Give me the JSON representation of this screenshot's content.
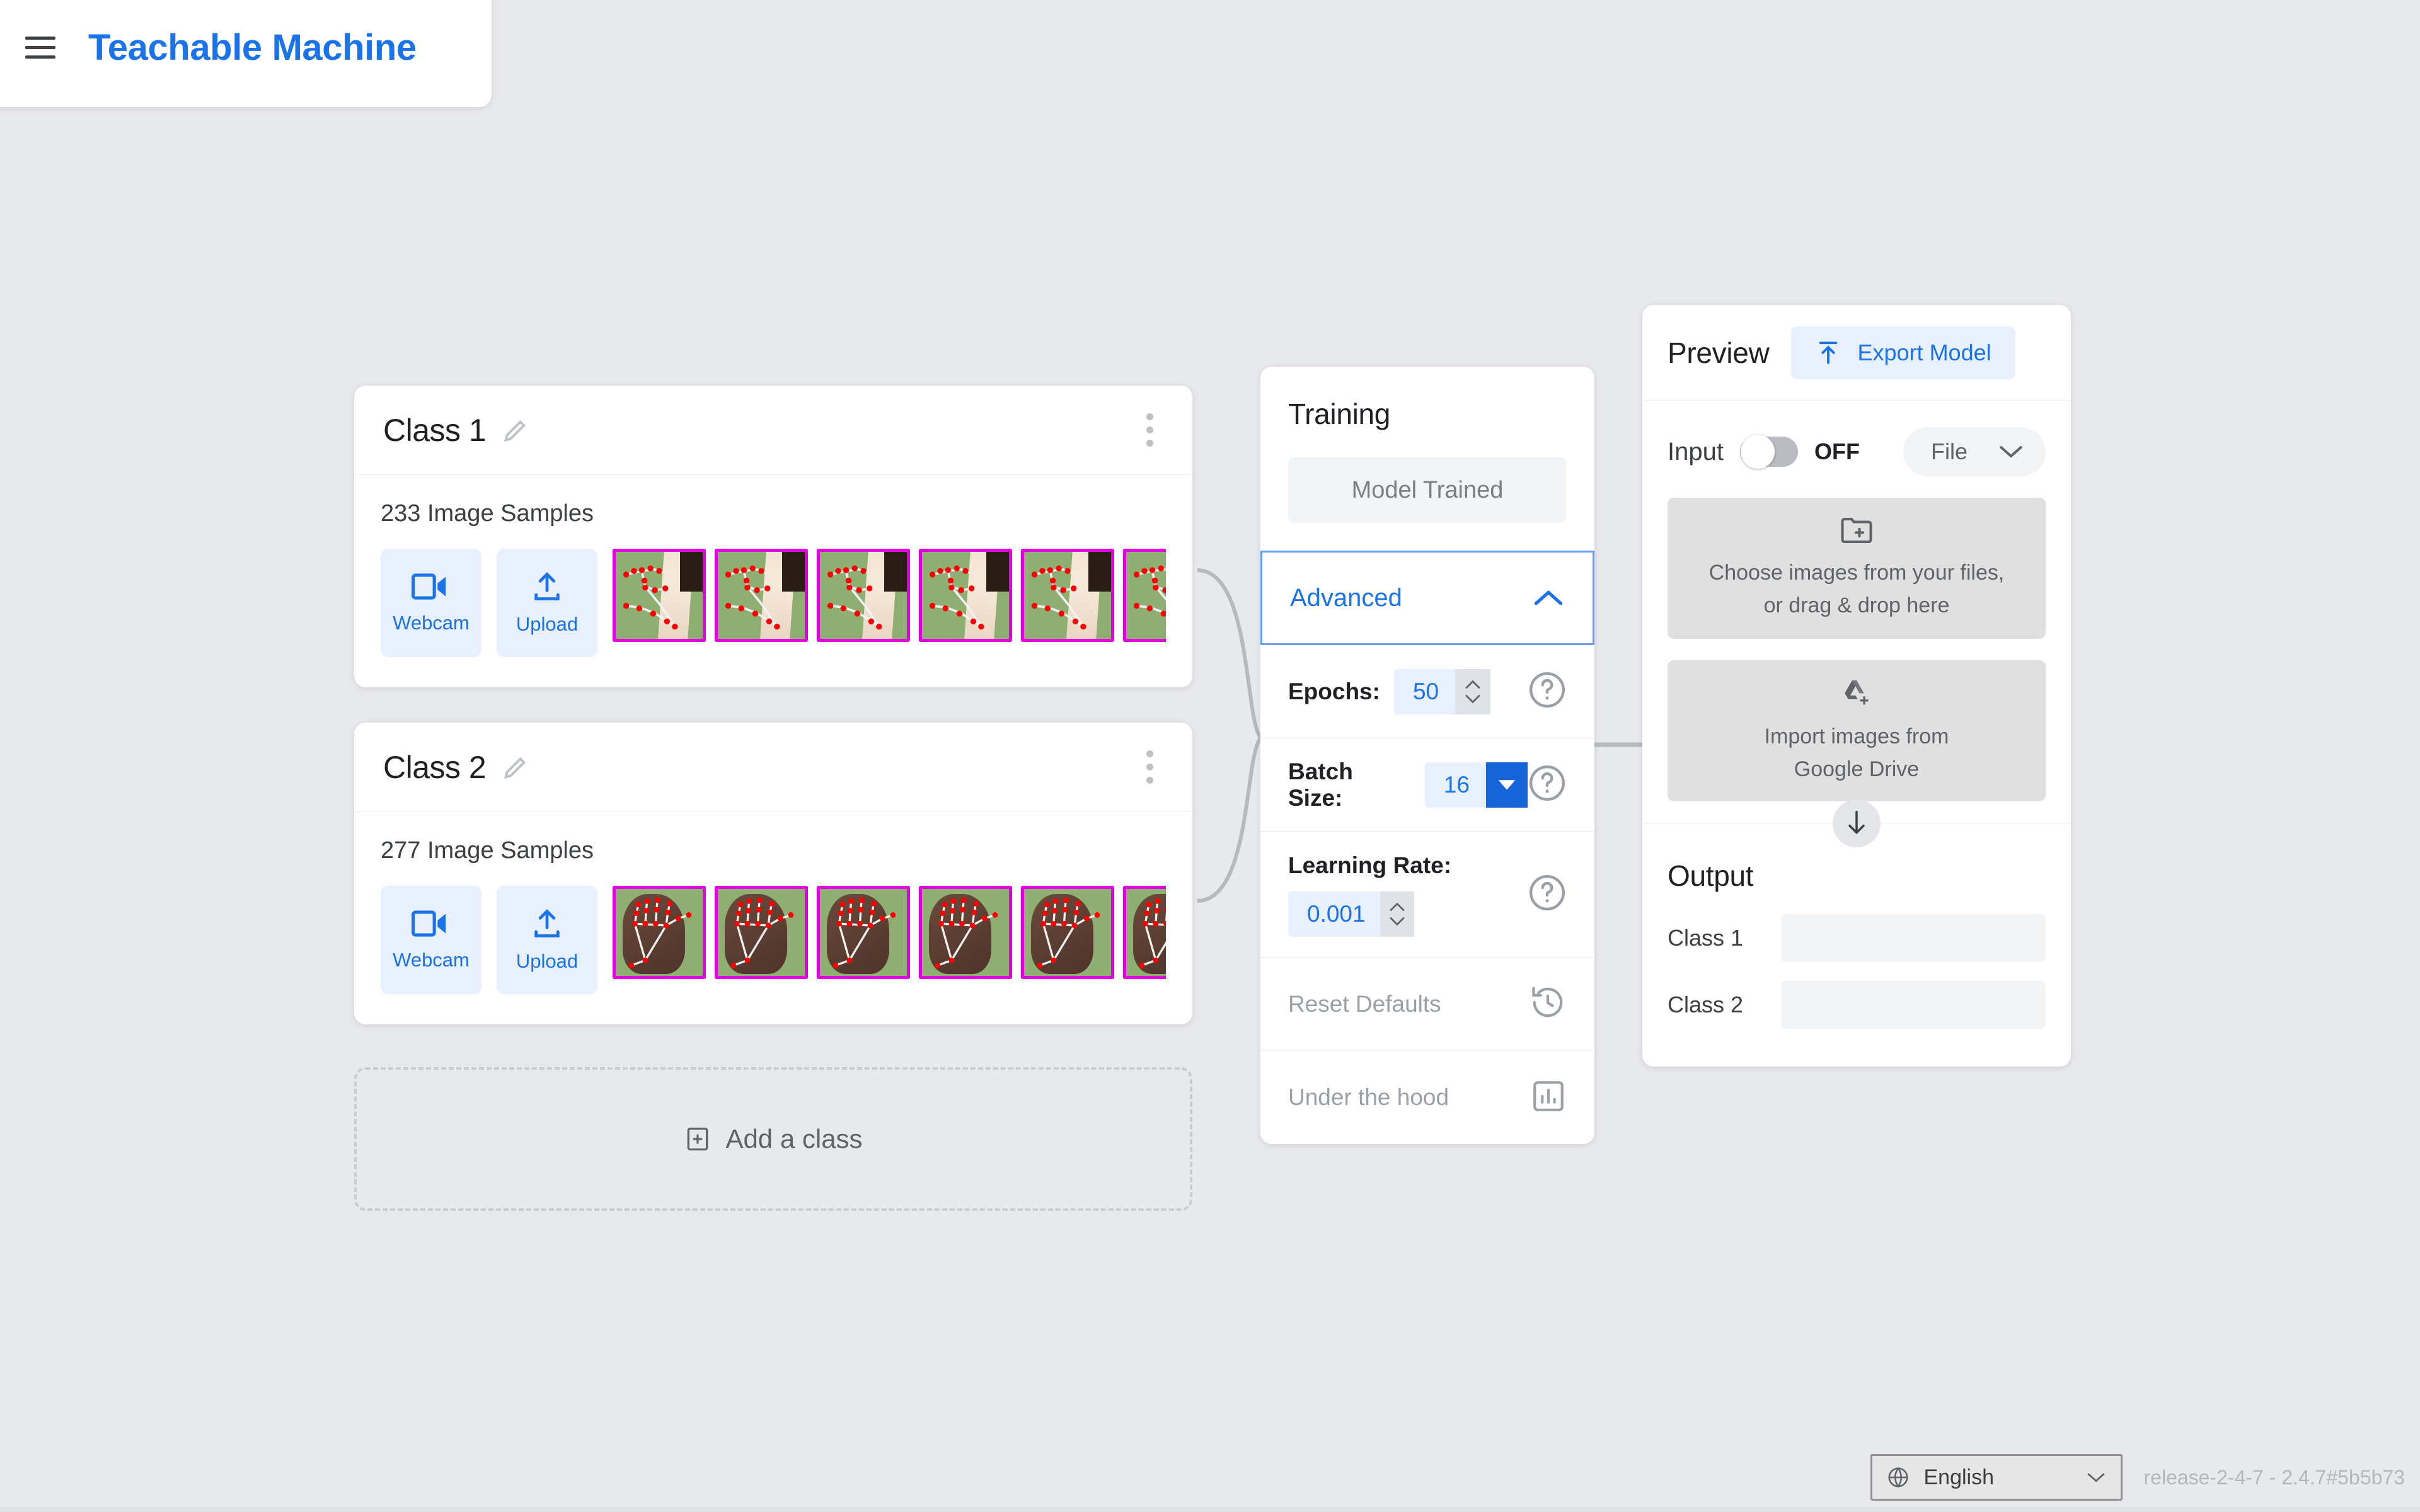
{
  "header": {
    "brand": "Teachable Machine",
    "menu_icon": "hamburger-icon"
  },
  "classes": [
    {
      "title": "Class 1",
      "samples_label": "233 Image Samples",
      "sample_count": 233,
      "webcam_label": "Webcam",
      "upload_label": "Upload",
      "thumbnail_count": 7,
      "thumbnail_kind": "hand-landmarks-fist"
    },
    {
      "title": "Class 2",
      "samples_label": "277 Image Samples",
      "sample_count": 277,
      "webcam_label": "Webcam",
      "upload_label": "Upload",
      "thumbnail_count": 7,
      "thumbnail_kind": "hand-landmarks-open"
    }
  ],
  "add_class": {
    "label": "Add a class"
  },
  "training": {
    "title": "Training",
    "train_button_label": "Model Trained",
    "advanced_label": "Advanced",
    "advanced_expanded": true,
    "epochs": {
      "label": "Epochs:",
      "value": "50"
    },
    "batch_size": {
      "label": "Batch Size:",
      "value": "16"
    },
    "learning_rate": {
      "label": "Learning Rate:",
      "value": "0.001"
    },
    "reset_defaults_label": "Reset Defaults",
    "under_the_hood_label": "Under the hood"
  },
  "preview": {
    "title": "Preview",
    "export_label": "Export Model",
    "input_label": "Input",
    "toggle_state": "OFF",
    "source_value": "File",
    "dropzone_files": "Choose images from your files,\nor drag & drop here",
    "dropzone_files_line1": "Choose images from your files,",
    "dropzone_files_line2": "or drag & drop here",
    "dropzone_drive_line1": "Import images from",
    "dropzone_drive_line2": "Google Drive",
    "output_title": "Output",
    "outputs": [
      {
        "name": "Class 1",
        "value": ""
      },
      {
        "name": "Class 2",
        "value": ""
      }
    ]
  },
  "footer": {
    "language": "English",
    "release": "release-2-4-7 - 2.4.7#5b5b73"
  },
  "colors": {
    "accent_blue": "#1a73e8",
    "accent_blue_dark": "#1565d8",
    "light_blue_bg": "#e8f0fe",
    "page_bg": "#e8e9ed",
    "thumb_border": "#e000e0",
    "thumb_bg": "#8fae72",
    "landmark_dot": "#ff0000"
  }
}
